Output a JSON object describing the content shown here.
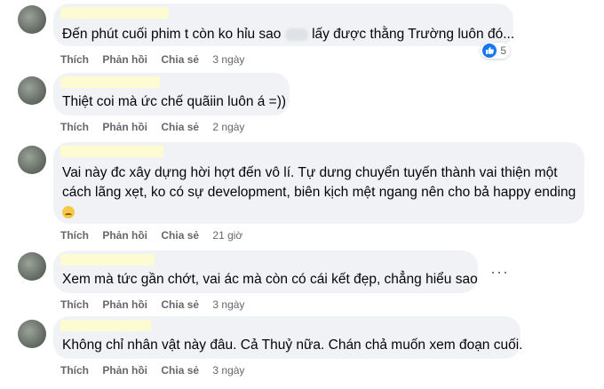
{
  "actions": {
    "like": "Thích",
    "reply": "Phản hồi",
    "share": "Chia sẻ"
  },
  "comments": [
    {
      "text": "Đến phút cuối phim t còn ko hỉu sao",
      "text_after": "lấy được thằng Trường luôn đó...",
      "time": "3 ngày",
      "reactions": "5"
    },
    {
      "text": "Thiệt coi mà ức chế quãiin luôn á =))",
      "time": "2 ngày"
    },
    {
      "line1": "Vai này đc xây dựng hời hợt đến vô lí. Tự dưng chuyển tuyến thành vai thiện một",
      "line2": "cách lãng xẹt, ko có sự development, biên kịch mệt ngang nên cho bả happy ending",
      "emoji": "sad-face-emoji",
      "time": "21 giờ"
    },
    {
      "text": "Xem mà tức gần chớt, vai ác mà còn có cái kết đẹp, chẳng hiểu sao",
      "time": "3 ngày",
      "more": "···"
    },
    {
      "text": "Không chỉ nhân vật này đâu. Cả Thuỷ nữa. Chán chả muốn xem đoạn cuối.",
      "time": "3 ngày"
    }
  ],
  "colors": {
    "bubble": "#f0f2f5",
    "action_text": "#65676b",
    "like_blue": "#1877f2",
    "name_redaction": "#fdfbd2"
  }
}
